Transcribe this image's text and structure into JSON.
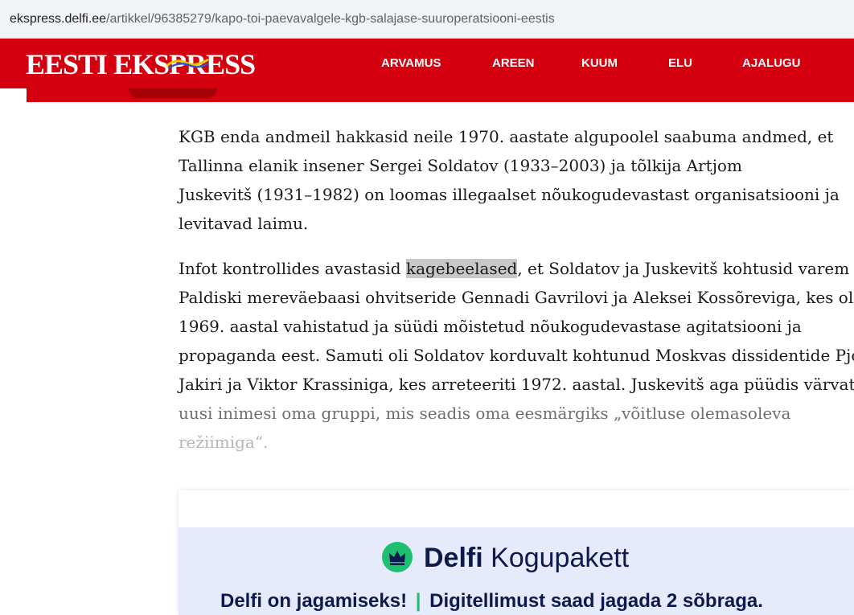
{
  "browser": {
    "url_host": "ekspress.delfi.ee",
    "url_path": "/artikkel/96385279/kapo-toi-paevavalgele-kgb-salajase-suuroperatsiooni-eestis"
  },
  "header": {
    "logo_text": "EESTI EKSPRESS",
    "nav": [
      "ARVAMUS",
      "AREEN",
      "KUUM",
      "ELU",
      "AJALUGU"
    ]
  },
  "article": {
    "p1_lines": [
      "KGB enda andmeil hakkasid neile 1970. aastate algupoolel saabuma andmed, et",
      "Tallinna elanik insener Sergei Soldatov (1933–2003) ja tõlkija Artjom",
      "Juskevitš (1931–1982) on loomas illegaalset nõukogudevastast organisatsiooni ja",
      "levitavad laimu."
    ],
    "p2_line1_pre": "Infot kontrollides avastasid ",
    "p2_line1_highlight": "kagebeelased",
    "p2_line1_post": ", et Soldatov ja Juskevitš kohtusid varem",
    "p2_lines": [
      "Paldiski mereväebaasi ohvitseride Gennadi Gavrilovi ja Aleksei Kossõreviga, kes olid",
      "1969. aastal vahistatud ja süüdi mõistetud nõukogudevastase agitatsiooni ja",
      "propaganda eest. Samuti oli Soldatov korduvalt kohtunud Moskvas dissidentide Pjotr",
      "Jakiri ja Viktor Krassiniga, kes arreteeriti 1972. aastal. Juskevitš aga püüdis värvata"
    ],
    "p2_fade_line1": "uusi inimesi oma gruppi, mis seadis oma eesmärgiks „võitluse olemasoleva",
    "p2_fade_line2": "režiimiga“."
  },
  "promo": {
    "brand_bold": "Delfi",
    "brand_rest": "Kogupakett",
    "tagline_left": "Delfi on jagamiseks!",
    "tagline_sep": "|",
    "tagline_right": "Digitellimust saad jagada 2 sõbraga."
  },
  "colors": {
    "header_red": "#d4000f",
    "promo_bg": "#e6ebfb",
    "promo_green": "#1fbf72",
    "promo_navy": "#0d1a4b"
  },
  "icons": {
    "promo_badge": "crown-icon"
  }
}
